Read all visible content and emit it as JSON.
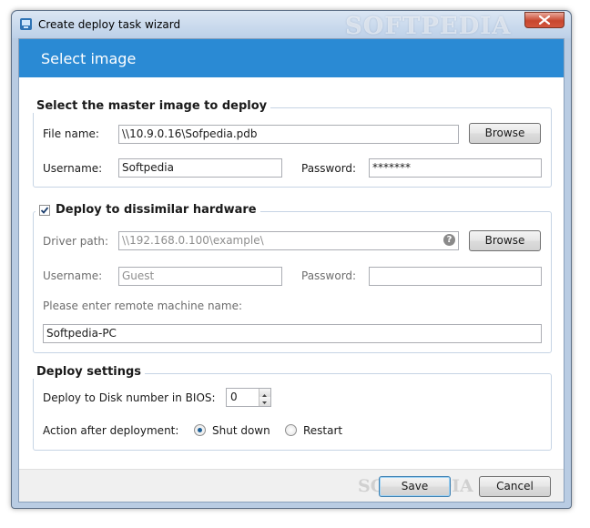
{
  "window": {
    "title": "Create deploy task wizard",
    "watermark": "SOFTPEDIA"
  },
  "header": {
    "title": "Select image"
  },
  "master_image": {
    "legend": "Select the master image to deploy",
    "file_name_label": "File name:",
    "file_name_value": "\\\\10.9.0.16\\Sofpedia.pdb",
    "browse_label": "Browse",
    "username_label": "Username:",
    "username_value": "Softpedia",
    "password_label": "Password:",
    "password_value": "*******"
  },
  "dissimilar": {
    "legend": "Deploy to dissimilar hardware",
    "checked": true,
    "driver_path_label": "Driver path:",
    "driver_path_value": "\\\\192.168.0.100\\example\\",
    "browse_label": "Browse",
    "username_label": "Username:",
    "username_value": "Guest",
    "password_label": "Password:",
    "password_value": "",
    "remote_prompt": "Please enter remote machine name:",
    "remote_value": "Softpedia-PC"
  },
  "deploy_settings": {
    "legend": "Deploy settings",
    "disk_label": "Deploy to Disk number in BIOS:",
    "disk_value": "0",
    "action_label": "Action after deployment:",
    "options": [
      "Shut down",
      "Restart"
    ],
    "selected": "Shut down"
  },
  "footer": {
    "save_label": "Save",
    "cancel_label": "Cancel",
    "watermark": "SOFTPEDIA"
  },
  "colors": {
    "header": "#2a8ad4",
    "window_frame": "#b9cce3",
    "close": "#c8462f"
  }
}
